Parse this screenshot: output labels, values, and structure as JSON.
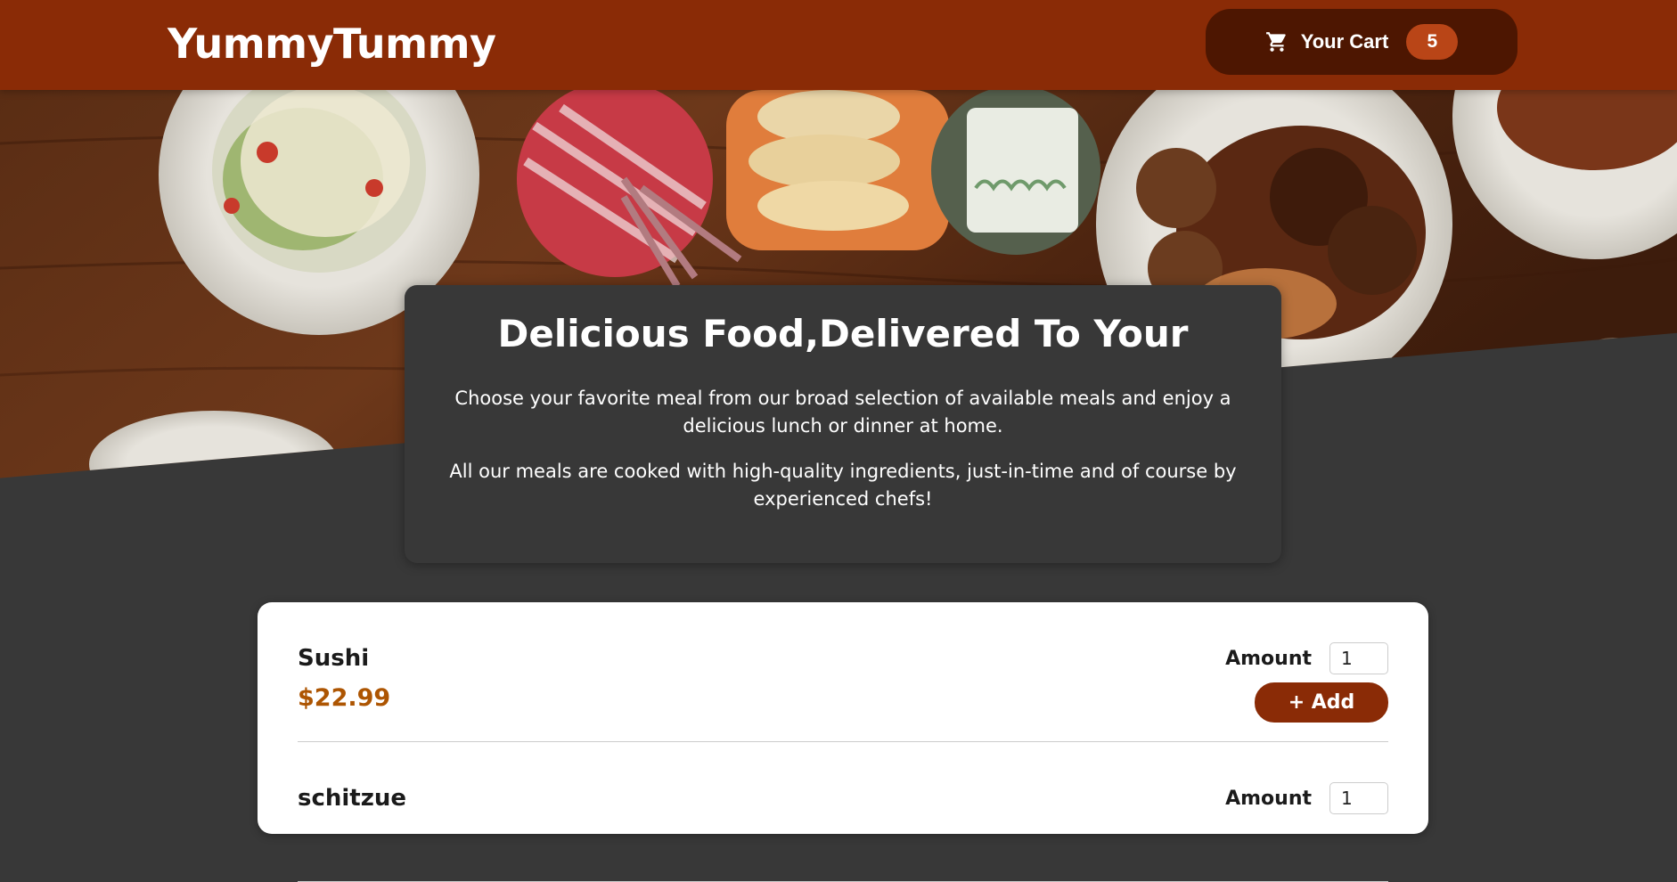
{
  "header": {
    "logo": "YummyTummy",
    "cart": {
      "label": "Your Cart",
      "count": "5",
      "icon": "cart-icon"
    }
  },
  "summary": {
    "title": "Delicious Food,Delivered To Your",
    "paragraph1": "Choose your favorite meal from our broad selection of available meals and enjoy a delicious lunch or dinner at home.",
    "paragraph2": "All our meals are cooked with high-quality ingredients, just-in-time and of course by experienced chefs!"
  },
  "meals": [
    {
      "name": "Sushi",
      "price": "$22.99",
      "amount_label": "Amount",
      "amount_value": "1",
      "add_label": "+ Add"
    },
    {
      "name": "schitzue",
      "amount_label": "Amount",
      "amount_value": "1"
    }
  ],
  "colors": {
    "header": "#8a2b06",
    "cart_button": "#4d1601",
    "cart_badge": "#b94517",
    "page_background": "#383838",
    "price": "#ad5502"
  }
}
